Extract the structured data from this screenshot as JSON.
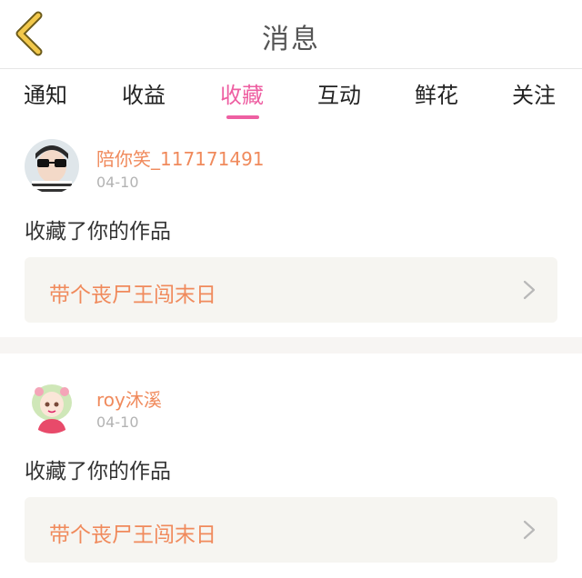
{
  "header": {
    "title": "消息",
    "back_icon": "chevron-left-icon",
    "back_color": "#f2c84b"
  },
  "tabs": [
    {
      "label": "通知"
    },
    {
      "label": "收益"
    },
    {
      "label": "收藏",
      "active": true
    },
    {
      "label": "互动"
    },
    {
      "label": "鲜花"
    },
    {
      "label": "关注"
    }
  ],
  "accent_color": "#ee5fa2",
  "name_color": "#f08a5c",
  "items": [
    {
      "username": "陪你笑_117171491",
      "date": "04-10",
      "action": "收藏了你的作品",
      "work_title": "带个丧尸王闯末日"
    },
    {
      "username": "roy沐溪",
      "date": "04-10",
      "action": "收藏了你的作品",
      "work_title": "带个丧尸王闯末日"
    }
  ]
}
